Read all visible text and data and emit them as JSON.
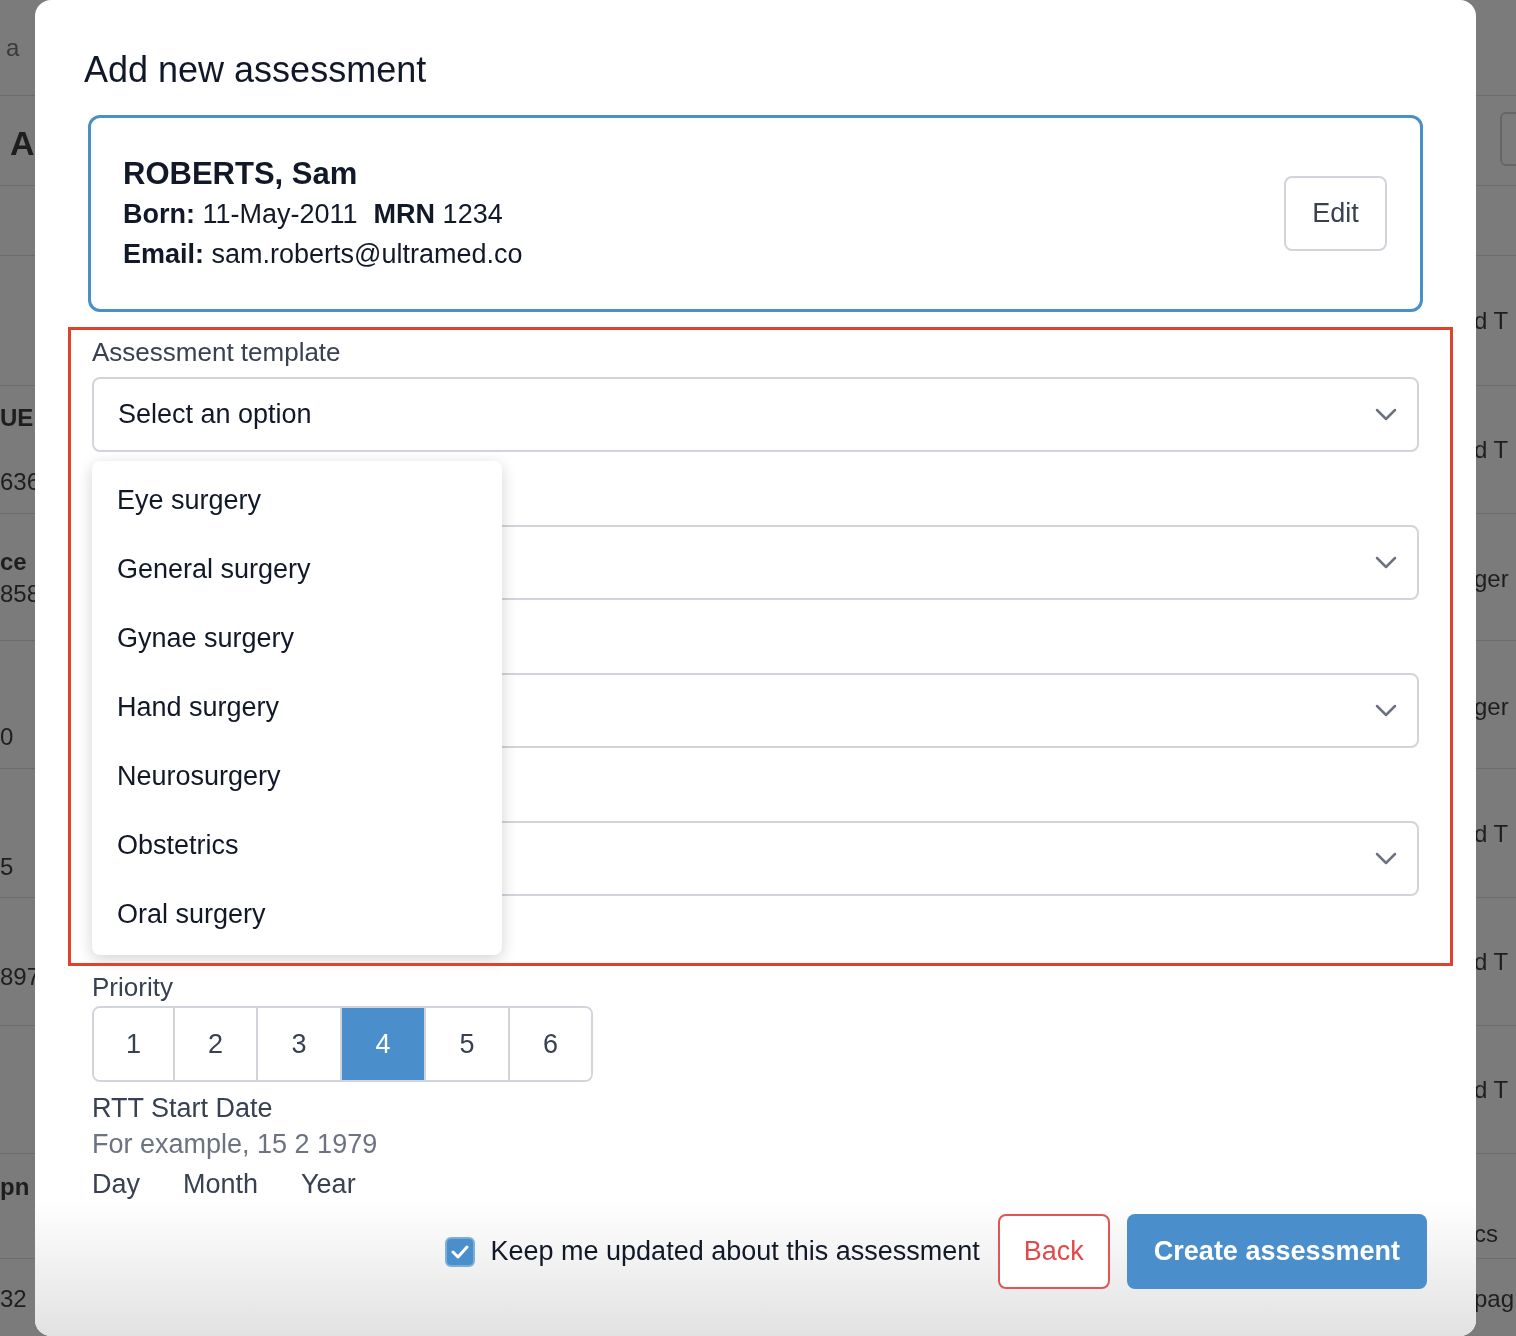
{
  "background": {
    "left_fragments": [
      {
        "text": "a",
        "kind": "plain"
      },
      {
        "text": "A",
        "kind": "heading"
      },
      {
        "text": "UE",
        "kind": "bold"
      },
      {
        "text": "636",
        "kind": "plain"
      },
      {
        "text": "ce",
        "kind": "bold"
      },
      {
        "text": "858",
        "kind": "plain"
      },
      {
        "text": "0",
        "kind": "plain"
      },
      {
        "text": "5",
        "kind": "plain"
      },
      {
        "text": "897",
        "kind": "plain"
      },
      {
        "text": "pn",
        "kind": "bold"
      },
      {
        "text": "32",
        "kind": "plain"
      }
    ],
    "right_fragments": [
      {
        "text": "d T"
      },
      {
        "text": "d T"
      },
      {
        "text": "ger"
      },
      {
        "text": "ger"
      },
      {
        "text": "d T"
      },
      {
        "text": "d T"
      },
      {
        "text": "d T"
      },
      {
        "text": "cs"
      },
      {
        "text": "pag"
      }
    ]
  },
  "modal": {
    "title": "Add new assessment",
    "patient": {
      "name": "ROBERTS, Sam",
      "born_label": "Born:",
      "born": "11-May-2011",
      "mrn_label": "MRN",
      "mrn": "1234",
      "email_label": "Email:",
      "email": "sam.roberts@ultramed.co",
      "edit_button": "Edit"
    },
    "template": {
      "label": "Assessment template",
      "value": "Select an option",
      "expanded": true,
      "options": [
        {
          "label": "Eye surgery"
        },
        {
          "label": "General surgery"
        },
        {
          "label": "Gynae surgery"
        },
        {
          "label": "Hand surgery"
        },
        {
          "label": "Neurosurgery"
        },
        {
          "label": "Obstetrics"
        },
        {
          "label": "Oral surgery"
        }
      ]
    },
    "covered_fields": [
      {
        "kind": "select"
      },
      {
        "kind": "select"
      },
      {
        "kind": "select"
      }
    ],
    "priority": {
      "label": "Priority",
      "options": [
        {
          "label": "1",
          "selected": false
        },
        {
          "label": "2",
          "selected": false
        },
        {
          "label": "3",
          "selected": false
        },
        {
          "label": "4",
          "selected": true
        },
        {
          "label": "5",
          "selected": false
        },
        {
          "label": "6",
          "selected": false
        }
      ]
    },
    "rtt": {
      "label": "RTT Start Date",
      "hint": "For example, 15 2 1979",
      "parts": [
        "Day",
        "Month",
        "Year"
      ]
    },
    "keep_updated": {
      "label": "Keep me updated about this assessment",
      "checked": true
    },
    "buttons": [
      {
        "label": "Back",
        "kind": "secondary"
      },
      {
        "label": "Create assessment",
        "kind": "primary"
      }
    ],
    "highlight_frame": true
  }
}
